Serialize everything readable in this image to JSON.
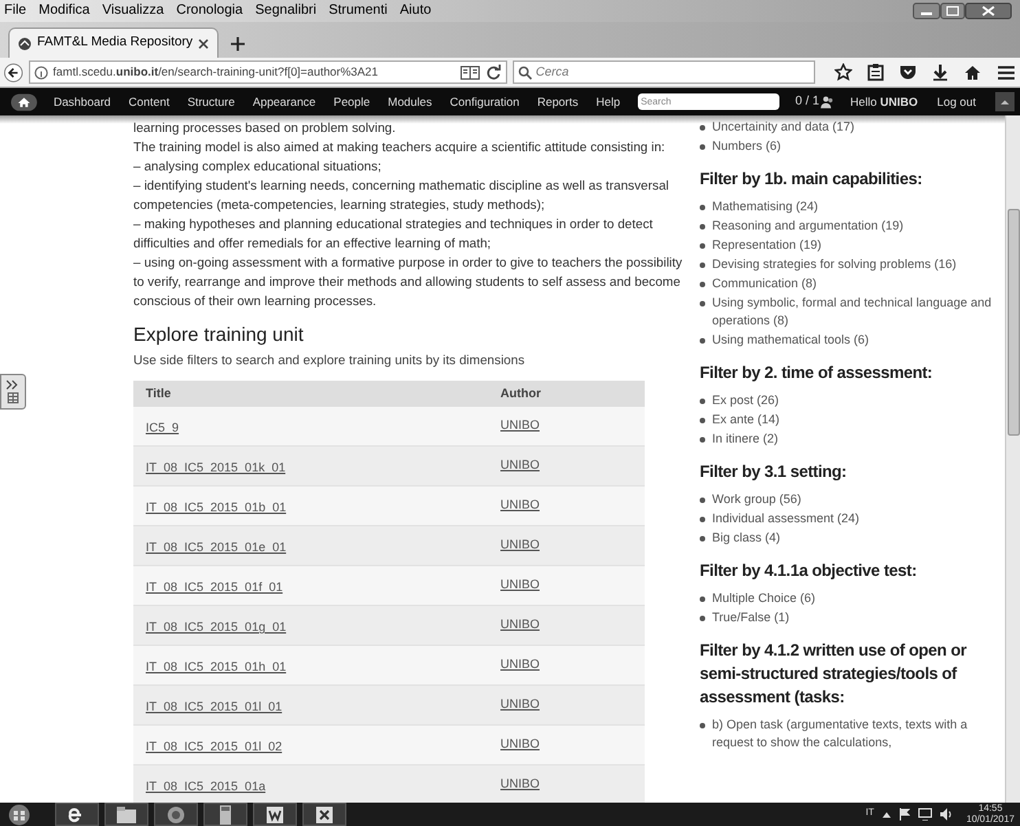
{
  "menu_bar": [
    "File",
    "Modifica",
    "Visualizza",
    "Cronologia",
    "Segnalibri",
    "Strumenti",
    "Aiuto"
  ],
  "tabs": [
    {
      "label": "FAMT&L Media Repository",
      "selected": true
    }
  ],
  "address_bar": {
    "url": "famtl.scedu.**unibo.it**/en/search-training-unit?f[0]=author%3A21"
  },
  "search_field": {
    "placeholder": "Cerca"
  },
  "admin_toolbar": {
    "items": [
      "Dashboard",
      "Content",
      "Structure",
      "Appearance",
      "People",
      "Modules",
      "Configuration",
      "Reports",
      "Help"
    ],
    "search": {
      "placeholder": "Search"
    },
    "users": "0 / 1",
    "greeting": "Hello **UNIBO**",
    "logout": "Log out"
  },
  "content": {
    "paragraphs": [
      "learning processes based on problem solving.",
      "The training model is also aimed at making teachers acquire a scientific attitude consisting in:",
      "– analysing complex educational situations;",
      "– identifying student's learning needs, concerning mathematic discipline as well as transversal competencies (meta-competencies, learning strategies, study methods);",
      "– making hypotheses and planning educational strategies and techniques in order to detect difficulties and offer remedials for an effective learning of math;",
      "– using on-going assessment with a formative purpose in order to give to teachers the possibility to verify, rearrange and improve their methods and allowing students to self assess and become conscious of their own learning processes."
    ],
    "heading": "Explore training unit",
    "intro": "Use side filters to search and explore training units by its dimensions",
    "table": {
      "columns": [
        "Title",
        "Author"
      ],
      "rows": [
        [
          "IC5_9",
          "UNIBO"
        ],
        [
          "IT_08_IC5_2015_01k_01",
          "UNIBO"
        ],
        [
          "IT_08_IC5_2015_01b_01",
          "UNIBO"
        ],
        [
          "IT_08_IC5_2015_01e_01",
          "UNIBO"
        ],
        [
          "IT_08_IC5_2015_01f_01",
          "UNIBO"
        ],
        [
          "IT_08_IC5_2015_01g_01",
          "UNIBO"
        ],
        [
          "IT_08_IC5_2015_01h_01",
          "UNIBO"
        ],
        [
          "IT_08_IC5_2015_01l_01",
          "UNIBO"
        ],
        [
          "IT_08_IC5_2015_01l_02",
          "UNIBO"
        ],
        [
          "IT_08_IC5_2015_01a",
          "UNIBO"
        ]
      ]
    }
  },
  "filters": [
    {
      "items": [
        "Uncertainity and data (17)",
        "Numbers (6)"
      ]
    },
    {
      "heading": "Filter by 1b. main capabilities:",
      "items": [
        "Mathematising (24)",
        "Reasoning and argumentation (19)",
        "Representation (19)",
        "Devising strategies for solving problems (16)",
        "Communication (8)",
        "Using symbolic, formal and technical language and operations (8)",
        "Using mathematical tools (6)"
      ]
    },
    {
      "heading": "Filter by 2. time of assessment:",
      "items": [
        "Ex post (26)",
        "Ex ante (14)",
        "In itinere (2)"
      ]
    },
    {
      "heading": "Filter by 3.1 setting:",
      "items": [
        "Work group (56)",
        "Individual assessment (24)",
        "Big class (4)"
      ]
    },
    {
      "heading": "Filter by 4.1.1a objective test:",
      "items": [
        "Multiple Choice (6)",
        "True/False (1)"
      ]
    },
    {
      "heading": "Filter by 4.1.2 written use of open or semi-structured strategies/tools of assessment (tasks:",
      "items": [
        "b) Open task (argumentative texts, texts with a request to show the calculations,"
      ]
    }
  ],
  "taskbar": {
    "apps": [
      {
        "kind": "ie"
      },
      {
        "kind": "folder"
      },
      {
        "kind": "firefox"
      },
      {
        "kind": "calculator"
      },
      {
        "kind": "word"
      },
      {
        "kind": "excel"
      }
    ],
    "language": "IT",
    "time": "14:55",
    "date": "10/01/2017"
  }
}
